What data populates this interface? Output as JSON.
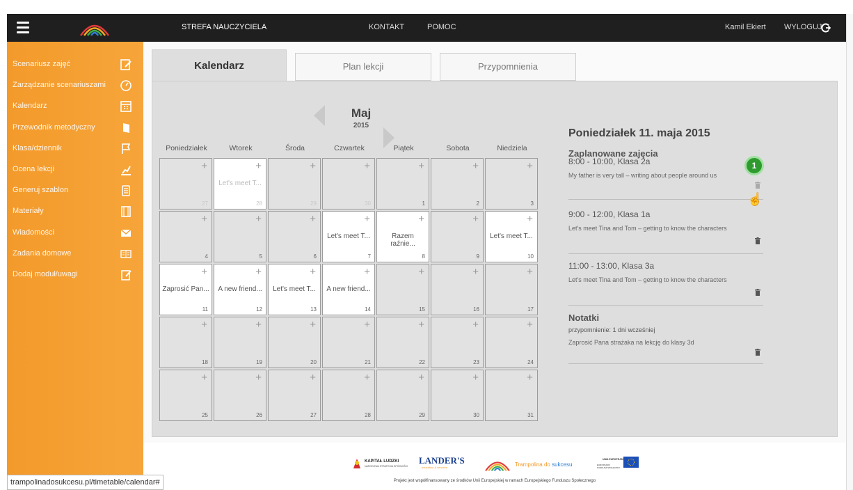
{
  "topbar": {
    "title": "STREFA NAUCZYCIELA",
    "contact": "KONTAKT",
    "help": "POMOC",
    "user": "Kamil Ekiert",
    "logout": "WYLOGUJ"
  },
  "sidebar": {
    "items": [
      {
        "label": "Scenariusz zajęć",
        "icon": "edit-icon"
      },
      {
        "label": "Zarządzanie scenariuszami",
        "icon": "gauge-icon"
      },
      {
        "label": "Kalendarz",
        "icon": "calendar-icon"
      },
      {
        "label": "Przewodnik metodyczny",
        "icon": "book-icon"
      },
      {
        "label": "Klasa/dziennik",
        "icon": "flag-icon"
      },
      {
        "label": "Ocena lekcji",
        "icon": "chart-icon"
      },
      {
        "label": "Generuj szablon",
        "icon": "document-icon"
      },
      {
        "label": "Materiały",
        "icon": "film-icon"
      },
      {
        "label": "Wiadomości",
        "icon": "mail-icon"
      },
      {
        "label": "Zadania domowe",
        "icon": "homework-icon"
      },
      {
        "label": "Dodaj moduł/uwagi",
        "icon": "note-icon"
      }
    ]
  },
  "tabs": [
    "Kalendarz",
    "Plan lekcji",
    "Przypomnienia"
  ],
  "calendar": {
    "month": "Maj",
    "year": "2015",
    "days": [
      "Poniedziałek",
      "Wtorek",
      "Środa",
      "Czwartek",
      "Piątek",
      "Sobota",
      "Niedziela"
    ],
    "weeks": [
      [
        {
          "n": "27",
          "o": true,
          "ev": ""
        },
        {
          "n": "28",
          "o": true,
          "ev": "Let's meet T...",
          "w": true
        },
        {
          "n": "29",
          "o": true,
          "ev": ""
        },
        {
          "n": "30",
          "o": true,
          "ev": ""
        },
        {
          "n": "1",
          "ev": ""
        },
        {
          "n": "2",
          "ev": ""
        },
        {
          "n": "3",
          "ev": ""
        }
      ],
      [
        {
          "n": "4",
          "ev": ""
        },
        {
          "n": "5",
          "ev": ""
        },
        {
          "n": "6",
          "ev": ""
        },
        {
          "n": "7",
          "ev": "Let's meet T...",
          "w": true
        },
        {
          "n": "8",
          "ev": "Razem raźnie...",
          "w": true
        },
        {
          "n": "9",
          "ev": ""
        },
        {
          "n": "10",
          "ev": "Let's meet T...",
          "w": true
        }
      ],
      [
        {
          "n": "11",
          "ev": "Zaprosić Pan...",
          "w": true
        },
        {
          "n": "12",
          "ev": "A new friend...",
          "w": true
        },
        {
          "n": "13",
          "ev": "Let's meet T...",
          "w": true
        },
        {
          "n": "14",
          "ev": "A new friend...",
          "w": true
        },
        {
          "n": "15",
          "ev": ""
        },
        {
          "n": "16",
          "ev": ""
        },
        {
          "n": "17",
          "ev": ""
        }
      ],
      [
        {
          "n": "18",
          "ev": ""
        },
        {
          "n": "19",
          "ev": ""
        },
        {
          "n": "20",
          "ev": ""
        },
        {
          "n": "21",
          "ev": ""
        },
        {
          "n": "22",
          "ev": ""
        },
        {
          "n": "23",
          "ev": ""
        },
        {
          "n": "24",
          "ev": ""
        }
      ],
      [
        {
          "n": "25",
          "ev": ""
        },
        {
          "n": "26",
          "ev": ""
        },
        {
          "n": "27",
          "ev": ""
        },
        {
          "n": "28",
          "ev": ""
        },
        {
          "n": "29",
          "ev": ""
        },
        {
          "n": "30",
          "ev": ""
        },
        {
          "n": "31",
          "ev": ""
        }
      ]
    ]
  },
  "details": {
    "date": "Poniedziałek 11. maja 2015",
    "planned": "Zaplanowane zajęcia",
    "slots": [
      {
        "time": "8:00 - 10:00, Klasa 2a",
        "desc": "My father is very tall – writing about people around us"
      },
      {
        "time": "9:00 - 12:00, Klasa 1a",
        "desc": "Let's meet Tina and Tom – getting to know the characters"
      },
      {
        "time": "11:00 - 13:00, Klasa 3a",
        "desc": "Let's meet Tina and Tom – getting to know the characters"
      }
    ],
    "notes_title": "Notatki",
    "reminder": "przypomnienie: 1 dni wcześniej",
    "note": "Zaprosić Pana strażaka na lekcję do klasy 3d"
  },
  "footer": {
    "kapital": "KAPITAŁ LUDZKI",
    "kapital_sub": "NARODOWA STRATEGIA SPÓJNOŚCI",
    "landers": "LANDER'S",
    "landers_sub": "education & services",
    "tramp1": "Trampolina do ",
    "tramp2": "sukcesu",
    "eu": "UNIA EUROPEJSKA",
    "eu_sub": "EUROPEJSKI FUNDUSZ SPOŁECZNY",
    "note": "Projekt jest współfinansowany ze środków Unii Europejskiej w ramach Europejskiego Funduszu Społecznego"
  },
  "status_url": "trampolinadosukcesu.pl/timetable/calendar#",
  "badge": "1",
  "colors": {
    "sidebar": "#f39a2b",
    "topbar": "#1f1f1f",
    "badge": "#2f9b2f"
  }
}
